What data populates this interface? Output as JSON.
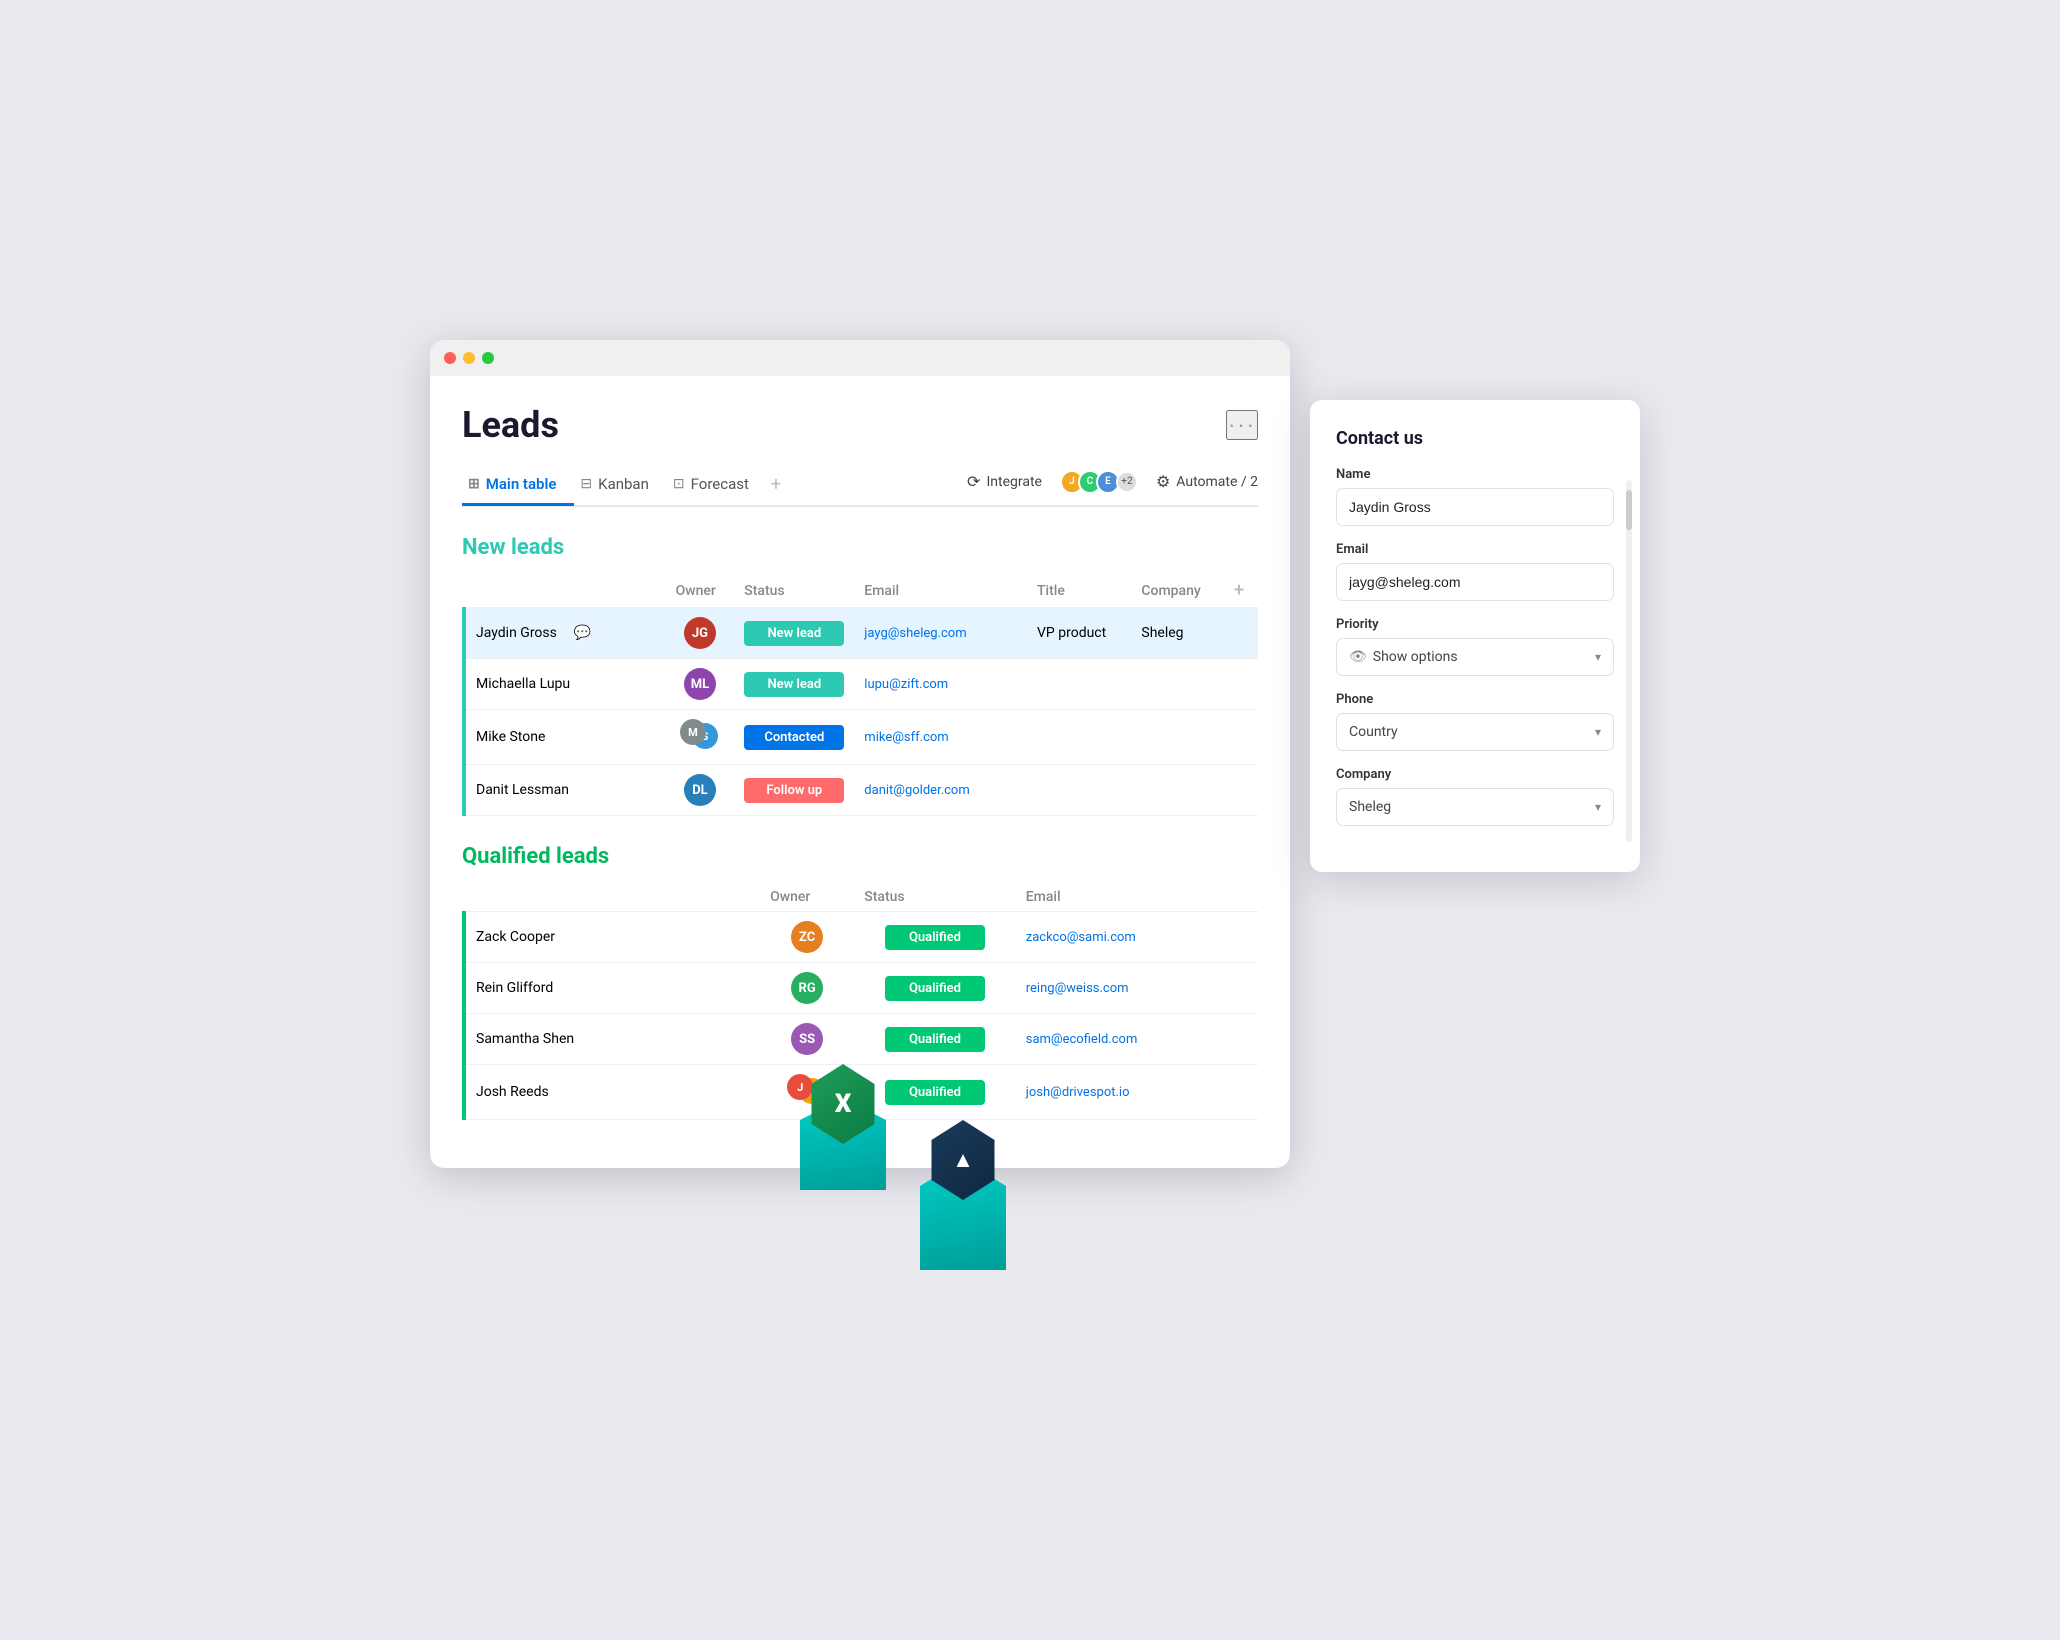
{
  "app": {
    "title": "Leads",
    "more_btn": "···"
  },
  "tabs": [
    {
      "id": "main-table",
      "label": "Main table",
      "icon": "⊞",
      "active": true
    },
    {
      "id": "kanban",
      "label": "Kanban",
      "icon": "⊟",
      "active": false
    },
    {
      "id": "forecast",
      "label": "Forecast",
      "icon": "⊡",
      "active": false
    }
  ],
  "toolbar": {
    "integrate_label": "Integrate",
    "automate_label": "Automate / 2",
    "plus_label": "+"
  },
  "new_leads": {
    "section_title": "New leads",
    "headers": [
      "Owner",
      "Status",
      "Email",
      "Title",
      "Company"
    ],
    "rows": [
      {
        "name": "Jaydin Gross",
        "owner_initials": "JG",
        "owner_color": "#c0392b",
        "status": "New lead",
        "status_type": "new",
        "email": "jayg@sheleg.com",
        "title": "VP product",
        "company": "Sheleg",
        "selected": true
      },
      {
        "name": "Michaella Lupu",
        "owner_initials": "ML",
        "owner_color": "#8e44ad",
        "status": "New lead",
        "status_type": "new",
        "email": "lupu@zift.com",
        "title": "",
        "company": "",
        "selected": false
      },
      {
        "name": "Mike Stone",
        "owner_initials": "MS",
        "owner_color": "#7f8c8d",
        "status": "Contacted",
        "status_type": "contacted",
        "email": "mike@sff.com",
        "title": "",
        "company": "",
        "selected": false,
        "dual": true
      },
      {
        "name": "Danit Lessman",
        "owner_initials": "DL",
        "owner_color": "#2980b9",
        "status": "Follow up",
        "status_type": "followup",
        "email": "danit@golder.com",
        "title": "",
        "company": "",
        "selected": false
      }
    ]
  },
  "qualified_leads": {
    "section_title": "Qualified leads",
    "headers": [
      "Owner",
      "Status",
      "Email"
    ],
    "rows": [
      {
        "name": "Zack Cooper",
        "owner_initials": "ZC",
        "owner_color": "#e67e22",
        "status": "Qualified",
        "status_type": "qualified",
        "email": "zackco@sami.com"
      },
      {
        "name": "Rein Glifford",
        "owner_initials": "RG",
        "owner_color": "#27ae60",
        "status": "Qualified",
        "status_type": "qualified",
        "email": "reing@weiss.com"
      },
      {
        "name": "Samantha Shen",
        "owner_initials": "SS",
        "owner_color": "#9b59b6",
        "status": "Qualified",
        "status_type": "qualified",
        "email": "sam@ecofield.com"
      },
      {
        "name": "Josh Reeds",
        "owner_initials": "JR",
        "owner_color": "#e74c3c",
        "status": "Qualified",
        "status_type": "qualified",
        "email": "josh@drivespot.io",
        "dual": true
      }
    ]
  },
  "contact_panel": {
    "title": "Contact us",
    "fields": {
      "name_label": "Name",
      "name_value": "Jaydin Gross",
      "email_label": "Email",
      "email_value": "jayg@sheleg.com",
      "priority_label": "Priority",
      "priority_placeholder": "Show options",
      "phone_label": "Phone",
      "phone_placeholder": "Country",
      "company_label": "Company",
      "company_value": "Sheleg"
    }
  },
  "icons": {
    "grid": "⊞",
    "columns": "⊟",
    "chart": "⊡",
    "plus": "+",
    "integrate": "⟳",
    "automate": "⚙",
    "eye": "👁",
    "chevron_down": "▾",
    "chat": "💬",
    "excel": "X",
    "dots": "···"
  }
}
